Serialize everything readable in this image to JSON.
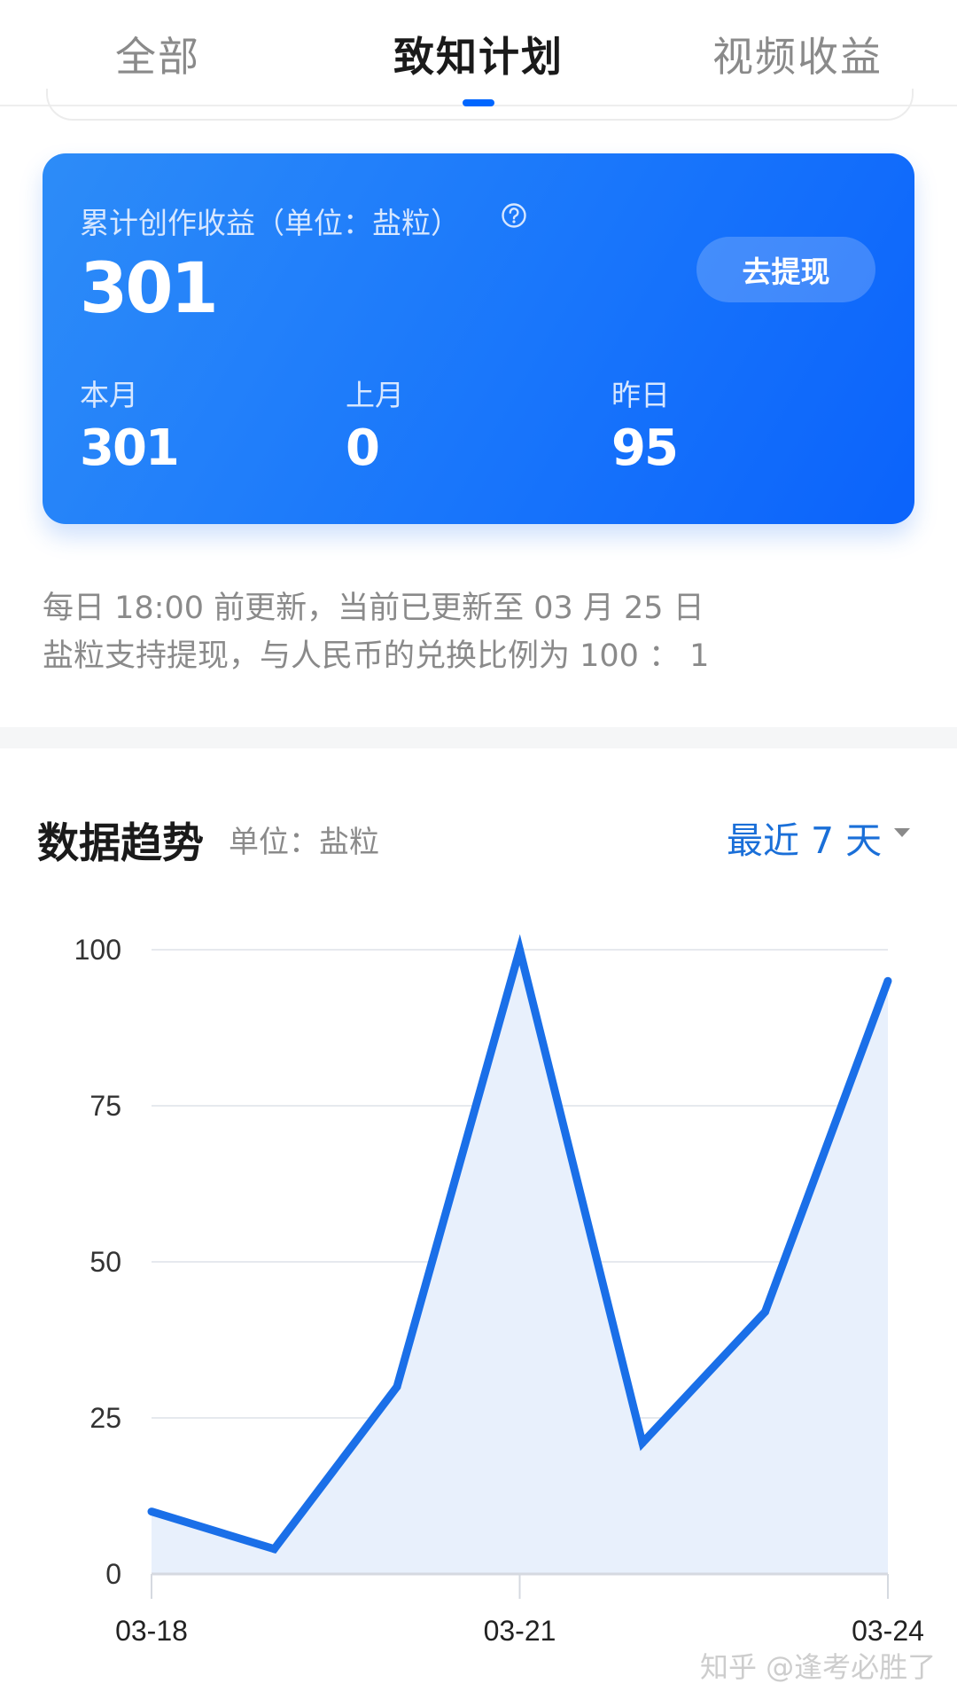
{
  "tabs": [
    {
      "label": "全部",
      "active": false
    },
    {
      "label": "致知计划",
      "active": true
    },
    {
      "label": "视频收益",
      "active": false
    }
  ],
  "card": {
    "title": "累计创作收益（单位：盐粒）",
    "help_icon": "question-circle-icon",
    "total": "301",
    "withdraw_label": "去提现",
    "stats": [
      {
        "label": "本月",
        "value": "301"
      },
      {
        "label": "上月",
        "value": "0"
      },
      {
        "label": "昨日",
        "value": "95"
      }
    ]
  },
  "notes": {
    "update": "每日 18:00 前更新，当前已更新至 03 月 25 日",
    "exchange": "盐粒支持提现，与人民币的兑换比例为 100 ： 1"
  },
  "trend": {
    "title": "数据趋势",
    "unit": "单位：盐粒",
    "range_label": "最近 7 天",
    "range_icon": "caret-down-icon"
  },
  "chart_data": {
    "type": "area",
    "x": [
      "03-18",
      "03-19",
      "03-20",
      "03-21",
      "03-22",
      "03-23",
      "03-24"
    ],
    "values": [
      10,
      4,
      30,
      100,
      21,
      42,
      95
    ],
    "x_tick_labels": [
      "03-18",
      "03-21",
      "03-24"
    ],
    "y_ticks": [
      0,
      25,
      50,
      75,
      100
    ],
    "ylim": [
      0,
      100
    ],
    "grid": true,
    "colors": {
      "line": "#1a6fe8",
      "fill": "#e8f0fc",
      "grid": "#e6e9ee"
    }
  },
  "watermark": "知乎 @逢考必胜了"
}
